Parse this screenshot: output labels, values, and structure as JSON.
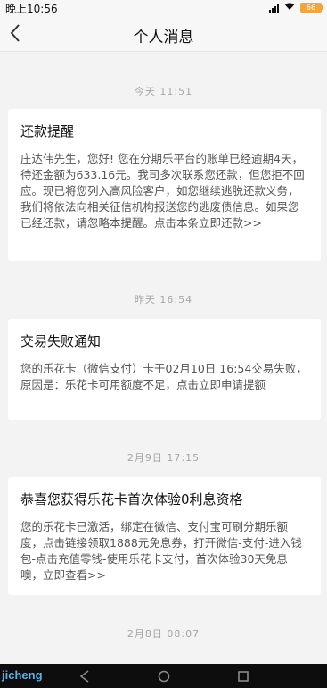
{
  "status_bar": {
    "time": "晚上10:56",
    "battery_level": "66"
  },
  "header": {
    "title": "个人消息"
  },
  "messages": [
    {
      "timestamp": "今天 11:51",
      "title": "还款提醒",
      "body": "庄达伟先生，您好! 您在分期乐平台的账单已经逾期4天，待还金额为633.16元。我司多次联系您还款，但您拒不回应。现已将您列入高风险客户，如您继续逃脱还款义务，我们将依法向相关征信机构报送您的逃废债信息。如果您已经还款，请忽略本提醒。点击本条立即还款>>"
    },
    {
      "timestamp": "昨天 16:54",
      "title": "交易失败通知",
      "body": "您的乐花卡（微信支付）卡于02月10日 16:54交易失败，原因是：乐花卡可用额度不足，点击立即申请提额"
    },
    {
      "timestamp": "2月9日 17:15",
      "title": "恭喜您获得乐花卡首次体验0利息资格",
      "body": "您的乐花卡已激活，绑定在微信、支付宝可刷分期乐额度，点击链接领取1888元免息券，打开微信-支付-进入钱包-点击充值零钱-使用乐花卡支付，首次体验30天免息噢，立即查看>>"
    },
    {
      "timestamp": "2月8日 08:07"
    }
  ],
  "watermark": "jicheng",
  "icons": {
    "back": "chevron-left-icon",
    "signal": "signal-icon",
    "wifi": "wifi-icon",
    "battery": "battery-icon",
    "nav_back": "nav-back-icon",
    "nav_home": "nav-home-icon",
    "nav_recent": "nav-recent-icon"
  }
}
